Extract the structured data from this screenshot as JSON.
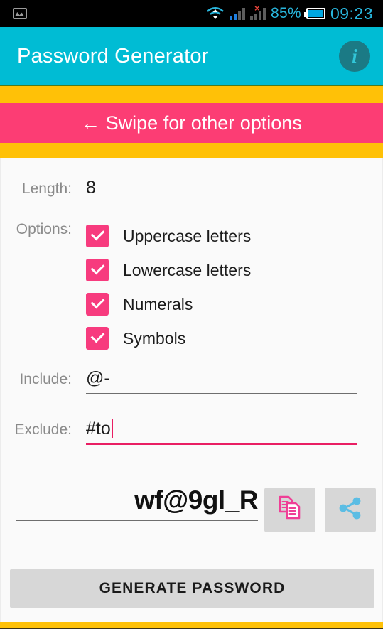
{
  "statusbar": {
    "photo_icon": "photo-icon",
    "wifi_icon": "wifi-icon",
    "signal_icon": "signal-bars-icon",
    "signal2_icon": "signal-bars-no-service-icon",
    "no_service_mark": "×",
    "battery_percent": "85%",
    "battery_icon": "battery-icon",
    "time": "09:23"
  },
  "appbar": {
    "title": "Password Generator",
    "info_label": "i"
  },
  "banner": {
    "swipe_text": "← Swipe for other options"
  },
  "form": {
    "length_label": "Length:",
    "length_value": "8",
    "options_label": "Options:",
    "options": [
      {
        "label": "Uppercase letters",
        "checked": true
      },
      {
        "label": "Lowercase letters",
        "checked": true
      },
      {
        "label": "Numerals",
        "checked": true
      },
      {
        "label": "Symbols",
        "checked": true
      }
    ],
    "include_label": "Include:",
    "include_value": "@-",
    "exclude_label": "Exclude:",
    "exclude_value": "#to"
  },
  "result": {
    "password": "wf@9gl_R",
    "copy_icon": "copy-icon",
    "share_icon": "share-icon"
  },
  "actions": {
    "generate_label": "GENERATE PASSWORD"
  },
  "colors": {
    "appbar": "#00bcd4",
    "accent_pink": "#f73b7e",
    "banner_pink": "#fc3d74",
    "band_yellow": "#ffc107",
    "copy_icon": "#ef3f96",
    "share_icon": "#5bbde4"
  }
}
